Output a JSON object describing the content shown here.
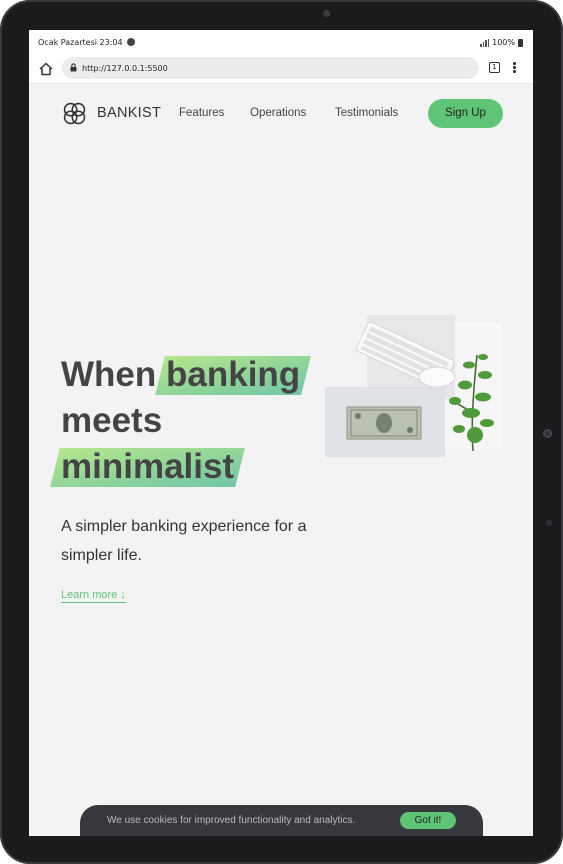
{
  "status_bar": {
    "time": "Ocak Pazartesi 23:04",
    "battery": "100%"
  },
  "browser": {
    "url": "http://127.0.0.1:5500",
    "tab_count": "1"
  },
  "nav": {
    "brand": "BANKIST",
    "links": [
      "Features",
      "Operations",
      "Testimonials"
    ],
    "signup_label": "Sign Up"
  },
  "hero": {
    "title_parts": [
      "When",
      "banking",
      "meets",
      "minimalist"
    ],
    "subtitle": "A simpler banking experience for a simpler life.",
    "learn_more": "Learn more ↓"
  },
  "cookie": {
    "message": "We use cookies for improved functionality and analytics.",
    "button": "Got it!"
  },
  "colors": {
    "accent": "#5ec576",
    "highlight_start": "#9be15d",
    "highlight_end": "#39b385",
    "background": "#f3f3f3"
  }
}
